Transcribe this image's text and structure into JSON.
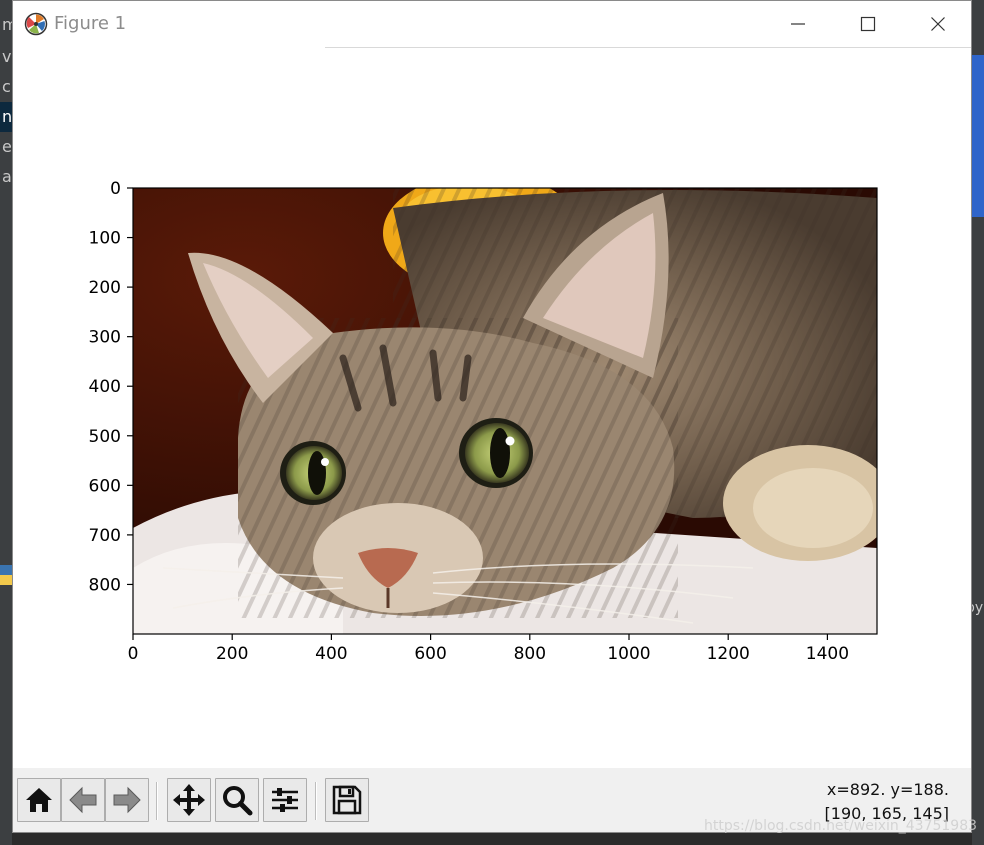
{
  "background": {
    "left_items": [
      "m",
      "v",
      "c",
      "n",
      "e",
      "a"
    ],
    "selected_index": 3,
    "right_text": "py"
  },
  "window": {
    "title": "Figure 1",
    "minimize_glyph": "—",
    "close_glyph": "✕"
  },
  "plot": {
    "image_width": 1500,
    "image_height": 900,
    "x_ticks": [
      "0",
      "200",
      "400",
      "600",
      "800",
      "1000",
      "1200",
      "1400"
    ],
    "y_ticks": [
      "0",
      "100",
      "200",
      "300",
      "400",
      "500",
      "600",
      "700",
      "800"
    ],
    "x_tick_values": [
      0,
      200,
      400,
      600,
      800,
      1000,
      1200,
      1400
    ],
    "y_tick_values": [
      0,
      100,
      200,
      300,
      400,
      500,
      600,
      700,
      800
    ]
  },
  "toolbar": {
    "buttons": [
      "home-icon",
      "back-arrow-icon",
      "forward-arrow-icon",
      "pan-icon",
      "zoom-icon",
      "configure-subplots-icon",
      "save-icon"
    ],
    "coords_readout": "x=892. y=188.",
    "pixel_readout": "[190, 165, 145]"
  },
  "watermark": "https://blog.csdn.net/weixin_43751983",
  "colors": {
    "toolbar_bg": "#f0f0f0",
    "window_bg": "#ffffff",
    "title_text": "#8c8c8c"
  }
}
